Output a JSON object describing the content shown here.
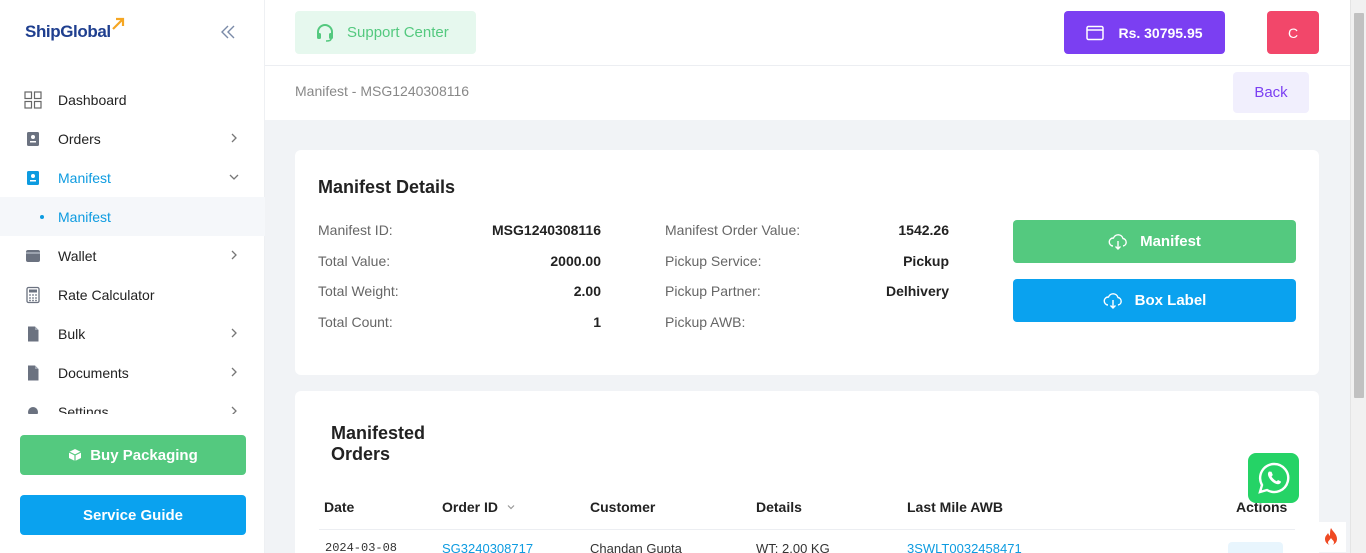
{
  "brand": {
    "logo_text": "ShipGlobal"
  },
  "sidebar": {
    "items": [
      {
        "label": "Dashboard",
        "icon": "dashboard-icon"
      },
      {
        "label": "Orders",
        "icon": "orders-icon"
      },
      {
        "label": "Manifest",
        "icon": "manifest-icon",
        "active": true
      },
      {
        "label": "Wallet",
        "icon": "wallet-icon"
      },
      {
        "label": "Rate Calculator",
        "icon": "calculator-icon"
      },
      {
        "label": "Bulk",
        "icon": "bulk-icon"
      },
      {
        "label": "Documents",
        "icon": "documents-icon"
      },
      {
        "label": "Settings",
        "icon": "settings-icon"
      }
    ],
    "sub_item": "Manifest",
    "buy_packaging": "Buy Packaging",
    "service_guide": "Service Guide"
  },
  "header": {
    "support": "Support Center",
    "wallet_balance": "Rs. 30795.95",
    "avatar_initial": "C"
  },
  "breadcrumb": {
    "text": "Manifest - MSG1240308116",
    "back": "Back"
  },
  "details": {
    "title": "Manifest Details",
    "left": [
      {
        "label": "Manifest ID:",
        "value": "MSG1240308116"
      },
      {
        "label": "Total Value:",
        "value": "2000.00"
      },
      {
        "label": "Total Weight:",
        "value": "2.00"
      },
      {
        "label": "Total Count:",
        "value": "1"
      }
    ],
    "right": [
      {
        "label": "Manifest Order Value:",
        "value": "1542.26"
      },
      {
        "label": "Pickup Service:",
        "value": "Pickup"
      },
      {
        "label": "Pickup Partner:",
        "value": "Delhivery"
      },
      {
        "label": "Pickup AWB:",
        "value": ""
      }
    ],
    "btn_manifest": "Manifest",
    "btn_box_label": "Box Label"
  },
  "orders": {
    "title": "Manifested Orders",
    "columns": [
      "Date",
      "Order ID",
      "Customer",
      "Details",
      "Last Mile AWB",
      "Actions"
    ],
    "rows": [
      {
        "date": "2024-03-08",
        "order_id": "SG3240308717",
        "customer": "Chandan Gupta",
        "details": "WT: 2.00 KG",
        "awb": "3SWLT0032458471"
      }
    ]
  },
  "colors": {
    "primary_blue": "#0aa2ef",
    "green": "#54c97f",
    "purple": "#7b3ff2",
    "pink": "#f2476a"
  }
}
